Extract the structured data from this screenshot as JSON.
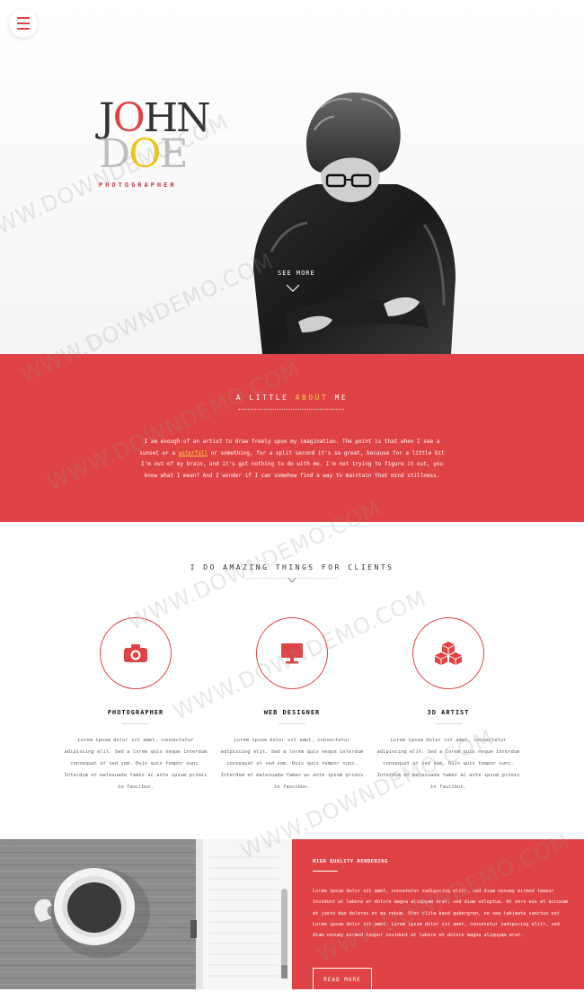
{
  "hero": {
    "logo": {
      "line1_a": "J",
      "line1_b": "O",
      "line1_c": "HN",
      "line2_a": "D",
      "line2_b": "O",
      "line2_c": "E",
      "subtitle": "PHOTOGRAPHER"
    },
    "see_more": "SEE MORE"
  },
  "about": {
    "heading_pre": "A LITTLE ",
    "heading_accent": "ABOUT",
    "heading_post": " ME",
    "text_1": "I am enough of an artist to draw freely upon my imagination. The point is that when I see a sunset or a ",
    "text_link": "waterfall",
    "text_2": " or something, for a split second it's so great, because for a little bit I'm out of my brain, and it's got nothing to do with me. I'm not trying to figure it out, you know what I mean? And I wonder if I can somehow find a way to maintain that mind stillness."
  },
  "services": {
    "heading": "I DO AMAZING THINGS FOR CLIENTS",
    "items": [
      {
        "title": "PHOTOGRAPHER",
        "icon": "camera-icon",
        "text": "Lorem ipsum dolor sit amet, consectetur adipiscing elit. Sed a lorem quis neque interdum consequat ut sed sem. Duis quis tempor nunc. Interdum et malesuada fames ac ante ipsum primis in faucibus."
      },
      {
        "title": "WEB DESIGNER",
        "icon": "monitor-icon",
        "text": "Lorem ipsum dolor sit amet, consectetur adipiscing elit. Sed a lorem quis neque interdum consequat ut sed sem. Duis quis tempor nunc. Interdum et malesuada fames ac ante ipsum primis in faucibus."
      },
      {
        "title": "3D ARTIST",
        "icon": "cubes-icon",
        "text": "Lorem ipsum dolor sit amet, consectetur adipiscing elit. Sed a lorem quis neque interdum consequat ut sed sem. Duis quis tempor nunc. Interdum et malesuada fames ac ante ipsum primis in faucibus."
      }
    ]
  },
  "quality": {
    "heading": "HIGH QUALITY RENDERING",
    "text": "Lorem ipsum dolor sit amet, consetetur sadipscing elitr, sed diam nonumy eirmod tempor invidunt ut labore et dolore magna aliquyam erat, sed diam voluptua. At vero eos et accusam et justo duo dolores et ea rebum. Stet clita kasd gubergren, no sea takimata sanctus est Lorem ipsum dolor sit amet. Lorem ipsum dolor sit amet, consetetur sadipscing elitr, sed diam nonumy eirmod tempor invidunt ut labore et dolore magna aliquyam erat.",
    "button": "READ MORE"
  },
  "watermark": "WWW.DOWNDEMO.COM",
  "colors": {
    "accent": "#e04345",
    "highlight": "#f7c94a"
  }
}
